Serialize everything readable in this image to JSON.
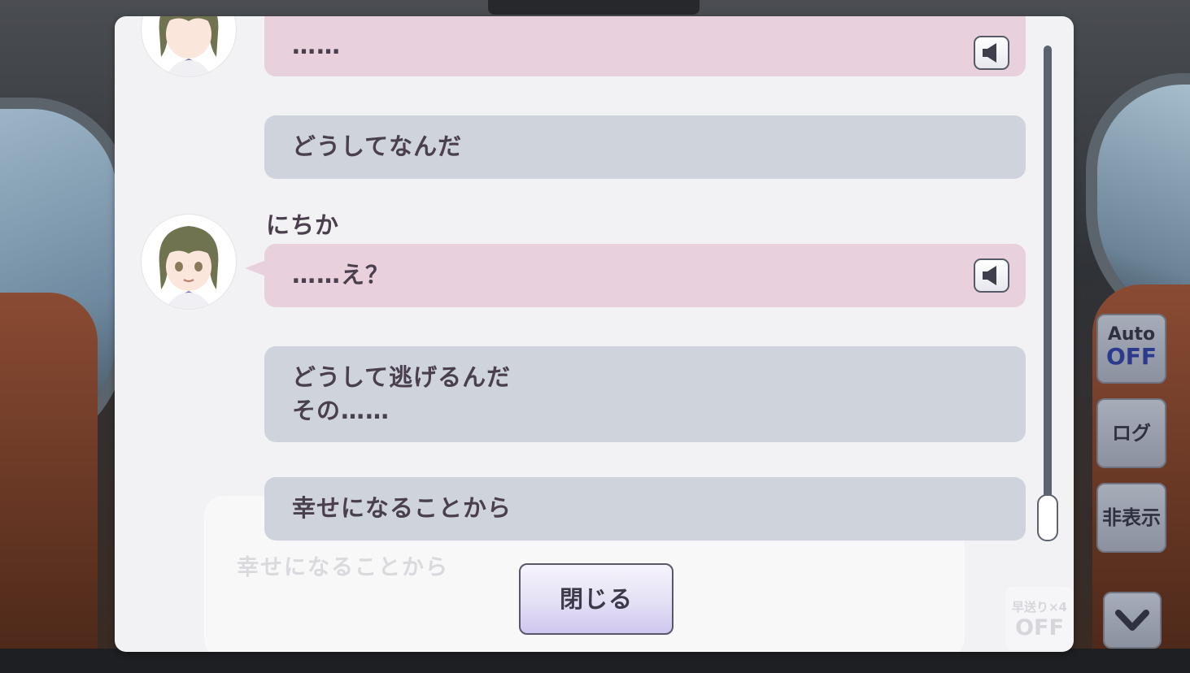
{
  "log_window": {
    "messages": [
      {
        "type": "character",
        "text_lines": [
          "……"
        ],
        "has_voice": true
      },
      {
        "type": "player",
        "text_lines": [
          "どうしてなんだ"
        ]
      },
      {
        "type": "character",
        "speaker": "にちか",
        "text_lines": [
          "……え？"
        ],
        "has_voice": true
      },
      {
        "type": "player",
        "text_lines": [
          "どうして逃げるんだ",
          "その……"
        ]
      },
      {
        "type": "player",
        "text_lines": [
          "幸せになることから"
        ]
      }
    ],
    "close_label": "閉じる"
  },
  "background_text": "幸せになることから",
  "side_buttons": {
    "auto_label": "Auto",
    "auto_state": "OFF",
    "log_label": "ログ",
    "hide_label": "非表示"
  },
  "fast_forward": {
    "label": "早送り×4",
    "state": "OFF"
  },
  "colors": {
    "character_bubble": "#e8d0dc",
    "player_bubble": "#cfd3dc",
    "text": "#4a3f4d",
    "auto_off": "#2a3a8c"
  }
}
